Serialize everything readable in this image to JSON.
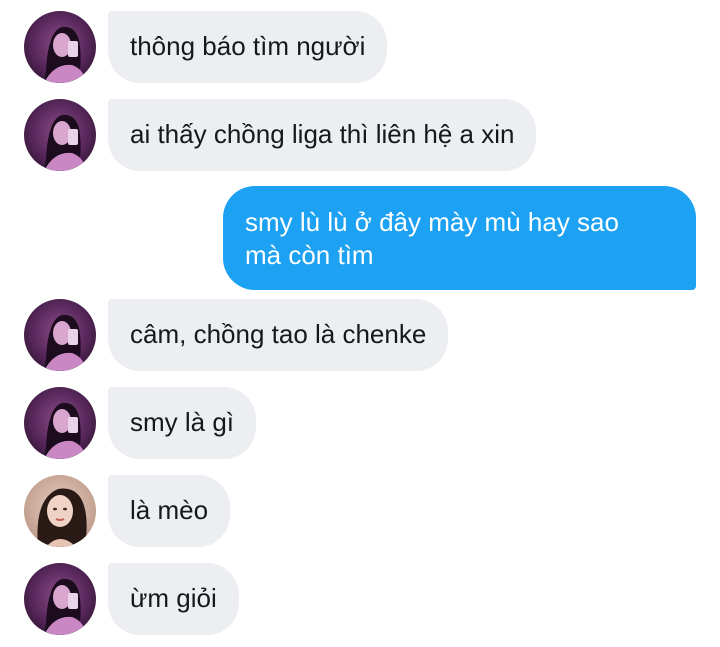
{
  "conversation": {
    "messages": [
      {
        "direction": "incoming",
        "avatar": "purple-selfie-avatar",
        "text": "thông báo tìm người"
      },
      {
        "direction": "incoming",
        "avatar": "purple-selfie-avatar",
        "text": "ai thấy chồng liga thì liên hệ a xin"
      },
      {
        "direction": "outgoing",
        "lines": [
          "smy lù lù ở đây mày mù hay sao",
          "mà còn tìm"
        ]
      },
      {
        "direction": "incoming",
        "avatar": "purple-selfie-avatar",
        "text": "câm, chồng tao là chenke"
      },
      {
        "direction": "incoming",
        "avatar": "purple-selfie-avatar",
        "text": "smy là gì"
      },
      {
        "direction": "incoming",
        "avatar": "portrait-avatar",
        "text": "là mèo"
      },
      {
        "direction": "incoming",
        "avatar": "purple-selfie-avatar",
        "text": "ừm giỏi"
      }
    ]
  },
  "colors": {
    "incoming_bubble": "#eceef1",
    "outgoing_bubble": "#1da1f2",
    "incoming_text": "#16191c",
    "outgoing_text": "#ffffff"
  }
}
